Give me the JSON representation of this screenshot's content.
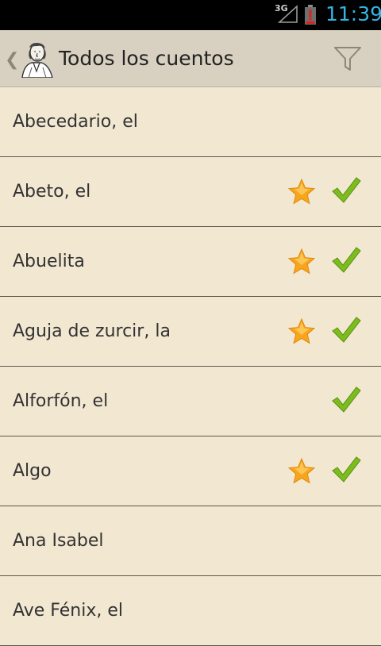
{
  "status_bar": {
    "network_label": "3G",
    "time": "11:39"
  },
  "action_bar": {
    "title": "Todos los cuentos",
    "icons": [
      "back-chevron",
      "author-portrait",
      "filter-funnel"
    ]
  },
  "stories": [
    {
      "title": "Abecedario, el",
      "favorite": false,
      "read": false
    },
    {
      "title": "Abeto, el",
      "favorite": true,
      "read": true
    },
    {
      "title": "Abuelita",
      "favorite": true,
      "read": true
    },
    {
      "title": "Aguja de zurcir, la",
      "favorite": true,
      "read": true
    },
    {
      "title": "Alforfón, el",
      "favorite": false,
      "read": true
    },
    {
      "title": "Algo",
      "favorite": true,
      "read": true
    },
    {
      "title": "Ana Isabel",
      "favorite": false,
      "read": false
    },
    {
      "title": "Ave Fénix, el",
      "favorite": false,
      "read": false
    }
  ],
  "colors": {
    "background": "#f2e8d2",
    "action_bar": "#d8d0c0",
    "clock": "#33b5e5",
    "star": "#f7a51c",
    "check": "#7cbc1e"
  }
}
